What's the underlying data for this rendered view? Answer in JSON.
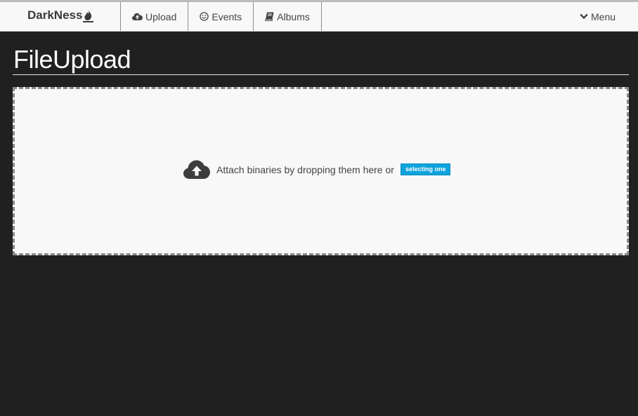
{
  "navbar": {
    "brand": "DarkNess",
    "items": [
      {
        "label": "Upload",
        "icon": "cloud-upload-icon"
      },
      {
        "label": "Events",
        "icon": "smiley-icon"
      },
      {
        "label": "Albums",
        "icon": "book-icon"
      }
    ],
    "menu_label": "Menu"
  },
  "page": {
    "title": "FileUpload"
  },
  "dropzone": {
    "message": "Attach binaries by dropping them here or",
    "select_label": "selecting one",
    "accent_color": "#0fa3dc"
  }
}
